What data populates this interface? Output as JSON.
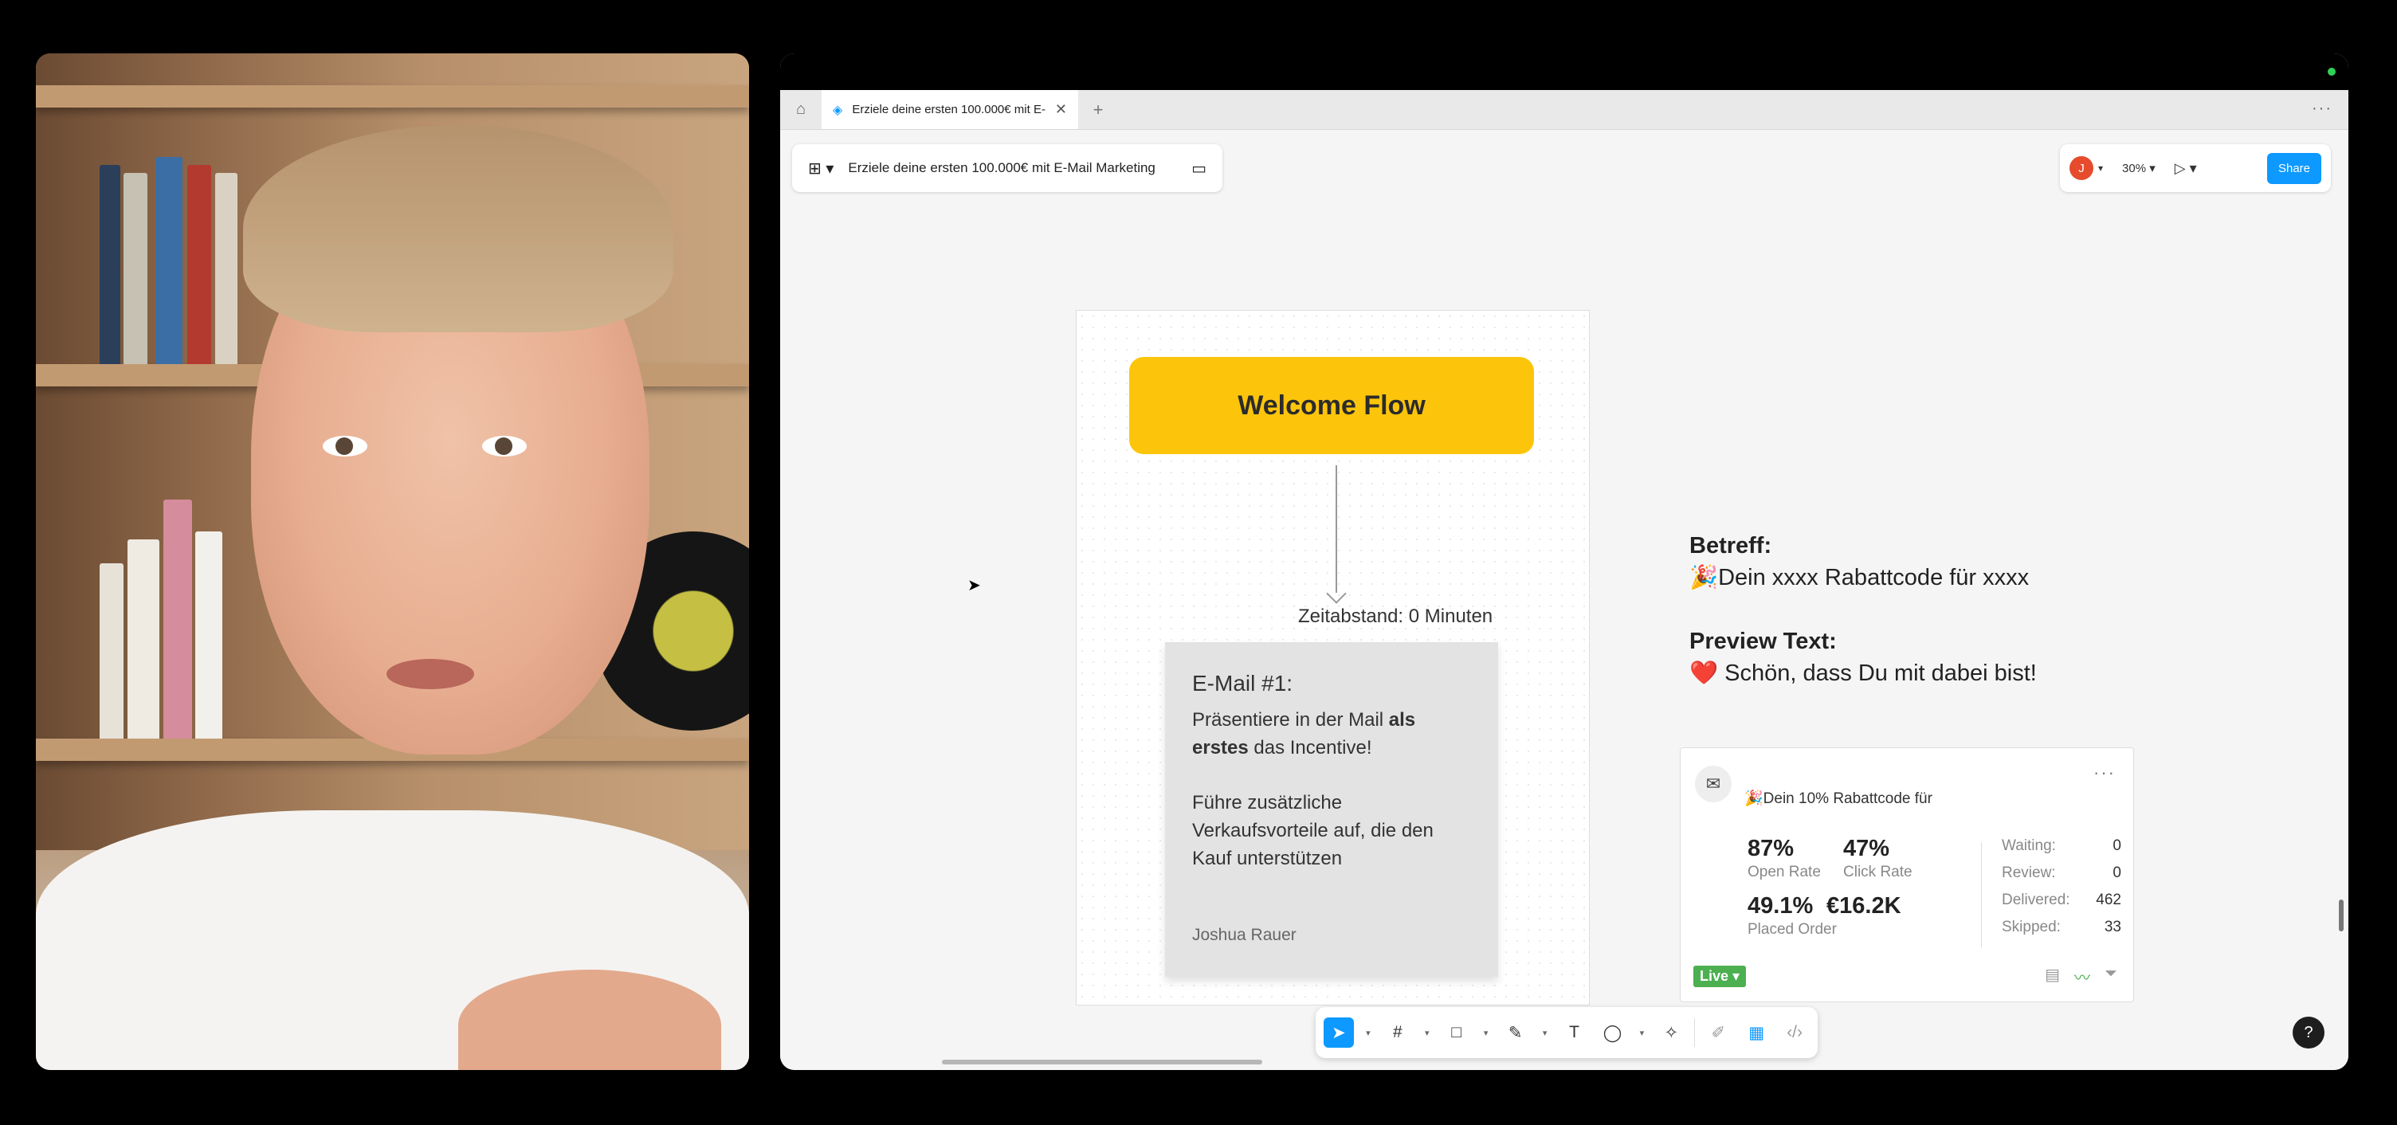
{
  "tabs": {
    "active_title": "Erziele deine ersten 100.000€ mit E-Mail Marketing"
  },
  "file": {
    "name": "Erziele deine ersten 100.000€ mit E-Mail Marketing"
  },
  "header": {
    "avatar_initial": "J",
    "zoom": "30%",
    "share_label": "Share"
  },
  "flow": {
    "title": "Welcome Flow",
    "delay": "Zeitabstand: 0 Minuten",
    "email": {
      "title": "E-Mail #1:",
      "line1_pre": "Präsentiere in der Mail ",
      "line1_bold": "als erstes",
      "line1_post": " das Incentive!",
      "line2": "Führe zusätzliche Verkaufsvorteile auf, die den Kauf unterstützen",
      "author": "Joshua Rauer"
    }
  },
  "side": {
    "subject_label": "Betreff:",
    "subject_value": "🎉Dein xxxx Rabattcode für xxxx",
    "preview_label": "Preview Text:",
    "preview_value": "❤️ Schön, dass Du mit dabei bist!"
  },
  "stats": {
    "subject": "🎉Dein 10% Rabattcode für",
    "open_rate": "87%",
    "open_rate_label": "Open Rate",
    "click_rate": "47%",
    "click_rate_label": "Click Rate",
    "placed_order": "49.1%",
    "placed_order_label": "Placed Order",
    "revenue": "€16.2K",
    "status": [
      {
        "label": "Waiting:",
        "value": "0"
      },
      {
        "label": "Review:",
        "value": "0"
      },
      {
        "label": "Delivered:",
        "value": "462"
      },
      {
        "label": "Skipped:",
        "value": "33"
      }
    ],
    "badge": "Live"
  },
  "help_label": "?"
}
